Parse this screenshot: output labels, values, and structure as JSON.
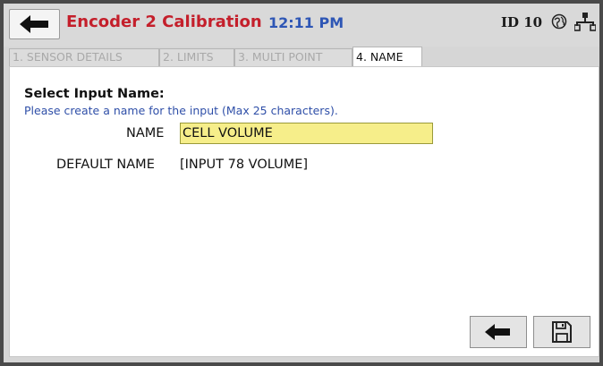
{
  "header": {
    "back_icon": "arrow-left-icon",
    "title": "Encoder 2 Calibration",
    "time": "12:11 PM",
    "device_id": "ID 10",
    "status_icons": [
      "globe-icon",
      "network-icon"
    ],
    "title_color": "#c41f2b",
    "time_color": "#2e56b5"
  },
  "tabs": [
    {
      "label": "1. SENSOR DETAILS",
      "active": false
    },
    {
      "label": "2. LIMITS",
      "active": false
    },
    {
      "label": "3. MULTI POINT",
      "active": false
    },
    {
      "label": "4. NAME",
      "active": true
    }
  ],
  "form": {
    "title": "Select Input Name:",
    "subtitle": "Please create a name for the input (Max 25 characters).",
    "name_label": "NAME",
    "name_value": "CELL VOLUME",
    "default_label": "DEFAULT NAME",
    "default_value": "[INPUT 78 VOLUME]",
    "name_field_color": "#f6ee8a"
  },
  "footer": {
    "back_icon": "arrow-left-icon",
    "save_icon": "floppy-disk-icon"
  }
}
